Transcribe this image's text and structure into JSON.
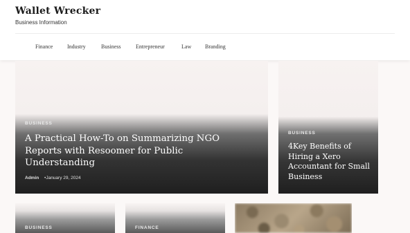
{
  "site": {
    "title": "Wallet Wrecker",
    "tagline": "Business Information"
  },
  "nav": {
    "items": [
      {
        "label": "Finance"
      },
      {
        "label": "Industry"
      },
      {
        "label": "Business"
      },
      {
        "label": "Entrepreneur"
      },
      {
        "label": "Law"
      },
      {
        "label": "Branding"
      }
    ]
  },
  "featured": {
    "category": "BUSINESS",
    "title": "A Practical How-To on Summarizing NGO Reports with Resoomer for Public Understanding",
    "author": "Admin",
    "date": "January 29, 2024"
  },
  "side_post": {
    "category": "BUSINESS",
    "title": "4Key Benefits of Hiring a Xero Accountant for Small Business"
  },
  "bottom_posts": [
    {
      "category": "BUSINESS"
    },
    {
      "category": "FINANCE"
    }
  ]
}
